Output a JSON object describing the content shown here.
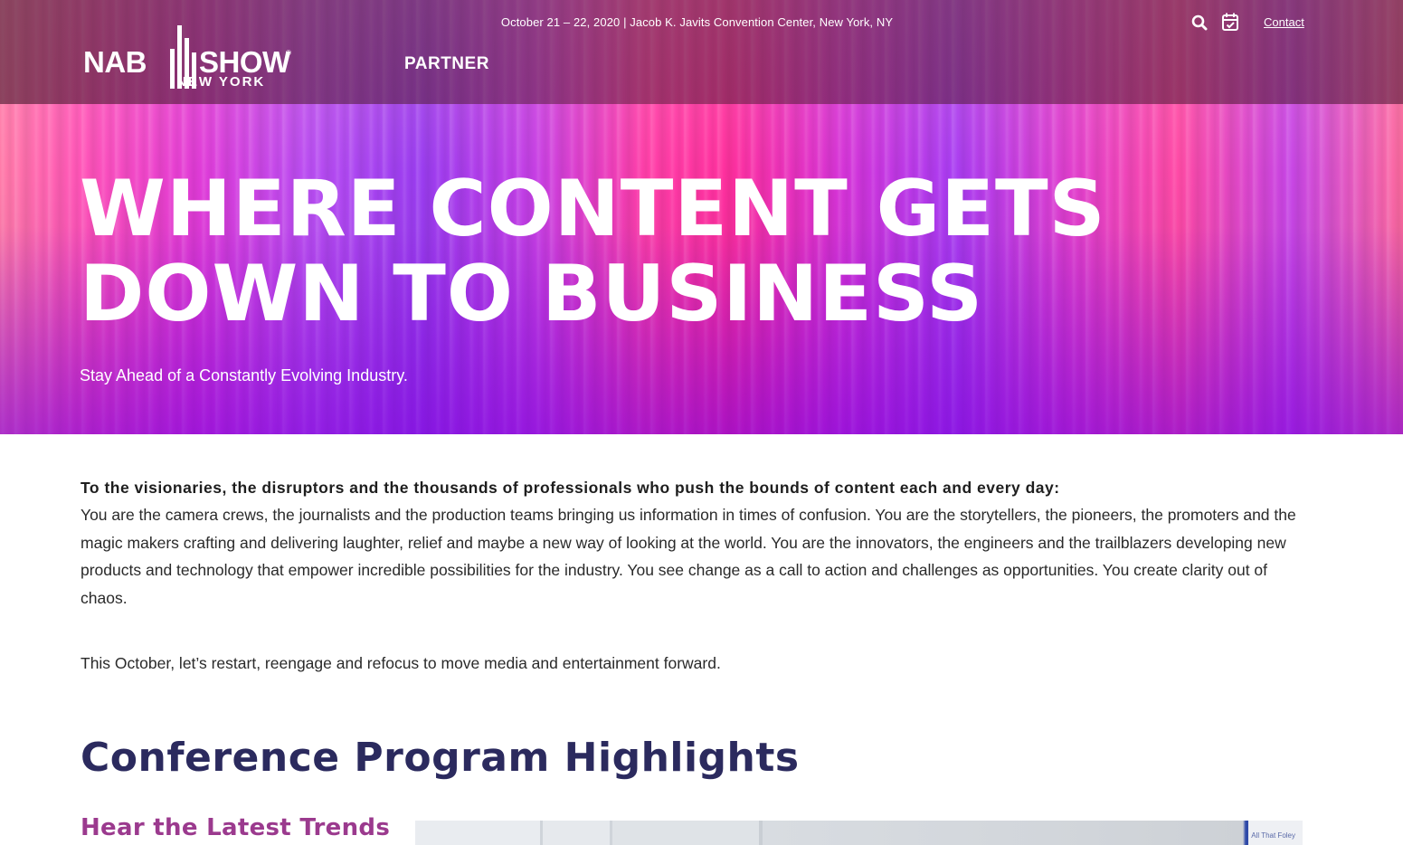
{
  "header": {
    "event_line": "October 21 – 22, 2020 | Jacob K. Javits Convention Center, New York, NY",
    "logo": {
      "word1": "NAB",
      "word2": "SHOW",
      "subline": "NEW YORK",
      "reg": "®"
    },
    "nav": {
      "partner_label": "PARTNER"
    },
    "icons": {
      "search": "search-icon",
      "calendar": "calendar-check-icon"
    },
    "contact_label": "Contact"
  },
  "hero": {
    "title_line1": "WHERE CONTENT GETS",
    "title_line2": "DOWN TO BUSINESS",
    "subtitle": "Stay Ahead of a Constantly Evolving Industry."
  },
  "intro": {
    "lead": "To the visionaries, the disruptors and the thousands of professionals who push the bounds of content each and every day:",
    "body": "You are the camera crews, the journalists and the production teams bringing us information in times of confusion. You are the storytellers, the pioneers, the promoters and the magic makers crafting and delivering laughter, relief and maybe a new way of looking at the world. You are the innovators, the engineers and the trailblazers developing new products and technology that empower incredible possibilities for the industry. You see change as a call to action and challenges as opportunities. You create clarity out of chaos.",
    "closing": "This October, let’s restart, reengage and refocus to move media and entertainment forward."
  },
  "program": {
    "title": "Conference Program Highlights",
    "subtitle": "Hear the Latest Trends",
    "photo_tag": "All That Foley"
  },
  "colors": {
    "hero_pink": "#ff3ea8",
    "hero_purple": "#9a3cf0",
    "section_title": "#2b2a5e",
    "sub_title": "#9b3a8e"
  }
}
